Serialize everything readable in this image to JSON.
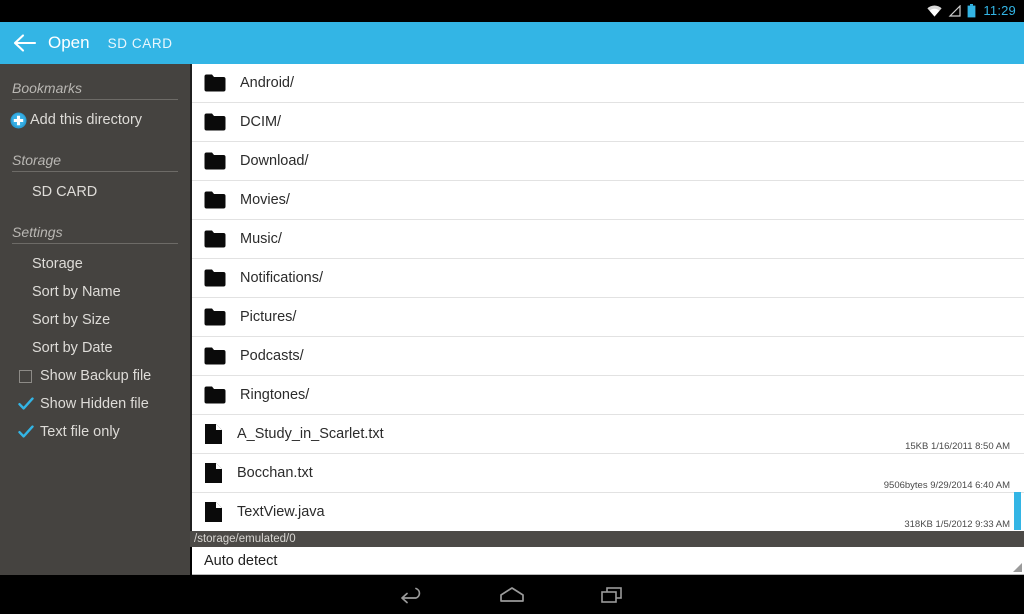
{
  "statusbar": {
    "clock": "11:29",
    "icons": [
      "wifi-icon",
      "signal-icon",
      "battery-icon"
    ]
  },
  "appbar": {
    "back_icon": "back-arrow-icon",
    "title": "Open",
    "subtitle": "SD CARD",
    "accent_color": "#33b5e5"
  },
  "sidebar": {
    "sections": [
      {
        "header": "Bookmarks",
        "items": [
          {
            "label": "Add this directory",
            "icon": "plus-circle-icon",
            "type": "action"
          }
        ]
      },
      {
        "header": "Storage",
        "items": [
          {
            "label": "SD CARD",
            "type": "plain"
          }
        ]
      },
      {
        "header": "Settings",
        "items": [
          {
            "label": "Storage",
            "type": "plain"
          },
          {
            "label": "Sort by Name",
            "type": "plain"
          },
          {
            "label": "Sort by Size",
            "type": "plain"
          },
          {
            "label": "Sort by Date",
            "type": "plain"
          },
          {
            "label": "Show Backup file",
            "type": "checkbox",
            "checked": false
          },
          {
            "label": "Show Hidden file",
            "type": "checkbox",
            "checked": true
          },
          {
            "label": "Text file only",
            "type": "checkbox",
            "checked": true
          }
        ]
      }
    ]
  },
  "filelist": {
    "rows": [
      {
        "name": "Android/",
        "kind": "folder",
        "meta": ""
      },
      {
        "name": "DCIM/",
        "kind": "folder",
        "meta": ""
      },
      {
        "name": "Download/",
        "kind": "folder",
        "meta": ""
      },
      {
        "name": "Movies/",
        "kind": "folder",
        "meta": ""
      },
      {
        "name": "Music/",
        "kind": "folder",
        "meta": ""
      },
      {
        "name": "Notifications/",
        "kind": "folder",
        "meta": ""
      },
      {
        "name": "Pictures/",
        "kind": "folder",
        "meta": ""
      },
      {
        "name": "Podcasts/",
        "kind": "folder",
        "meta": ""
      },
      {
        "name": "Ringtones/",
        "kind": "folder",
        "meta": ""
      },
      {
        "name": "A_Study_in_Scarlet.txt",
        "kind": "file",
        "meta": "15KB 1/16/2011 8:50 AM"
      },
      {
        "name": "Bocchan.txt",
        "kind": "file",
        "meta": "9506bytes 9/29/2014 6:40 AM"
      },
      {
        "name": "TextView.java",
        "kind": "file",
        "meta": "318KB 1/5/2012 9:33 AM"
      }
    ],
    "scrollbar_color": "#33b5e5"
  },
  "pathbar": {
    "path": "/storage/emulated/0"
  },
  "spinner": {
    "value": "Auto detect",
    "caret_icon": "dropdown-caret-icon"
  },
  "navbar": {
    "buttons": [
      {
        "icon": "back-nav-icon"
      },
      {
        "icon": "home-nav-icon"
      },
      {
        "icon": "recents-nav-icon"
      }
    ]
  }
}
